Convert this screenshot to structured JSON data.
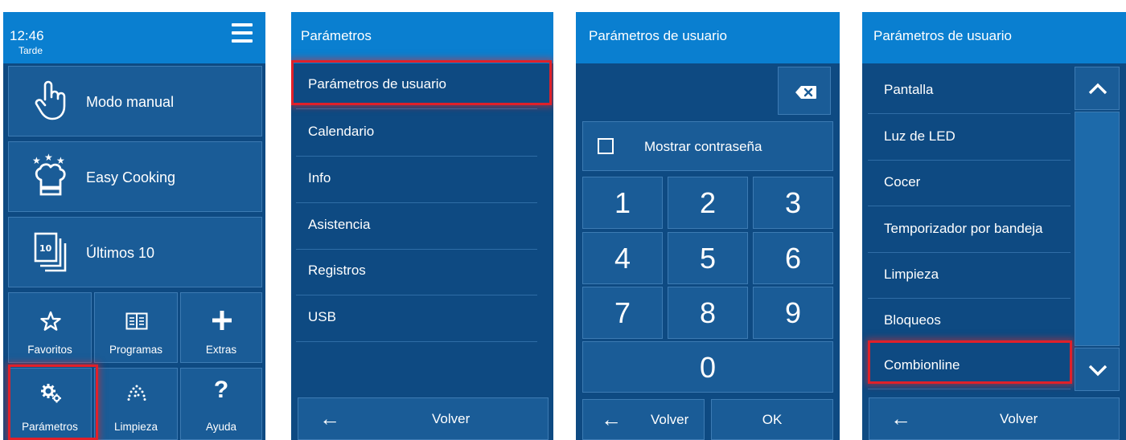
{
  "screen1": {
    "time": "12:46",
    "period": "Tarde",
    "tiles": {
      "manual": "Modo manual",
      "easy": "Easy Cooking",
      "last10": "Últimos 10",
      "last10_badge": "10"
    },
    "small": {
      "favoritos": "Favoritos",
      "programas": "Programas",
      "extras": "Extras",
      "parametros": "Parámetros",
      "limpieza": "Limpieza",
      "ayuda": "Ayuda"
    }
  },
  "screen2": {
    "title": "Parámetros",
    "items": [
      "Parámetros de usuario",
      "Calendario",
      "Info",
      "Asistencia",
      "Registros",
      "USB"
    ],
    "back": "Volver"
  },
  "screen3": {
    "title": "Parámetros de usuario",
    "show_password": "Mostrar contraseña",
    "keys": [
      "1",
      "2",
      "3",
      "4",
      "5",
      "6",
      "7",
      "8",
      "9",
      "0"
    ],
    "back": "Volver",
    "ok": "OK"
  },
  "screen4": {
    "title": "Parámetros de usuario",
    "items": [
      "Pantalla",
      "Luz de LED",
      "Cocer",
      "Temporizador por bandeja",
      "Limpieza",
      "Bloqueos",
      "Combionline"
    ],
    "back": "Volver"
  },
  "colors": {
    "header": "#0a7fd0",
    "panel": "#0e4a82",
    "tile": "#1a5c97",
    "highlight": "#e0202a"
  }
}
